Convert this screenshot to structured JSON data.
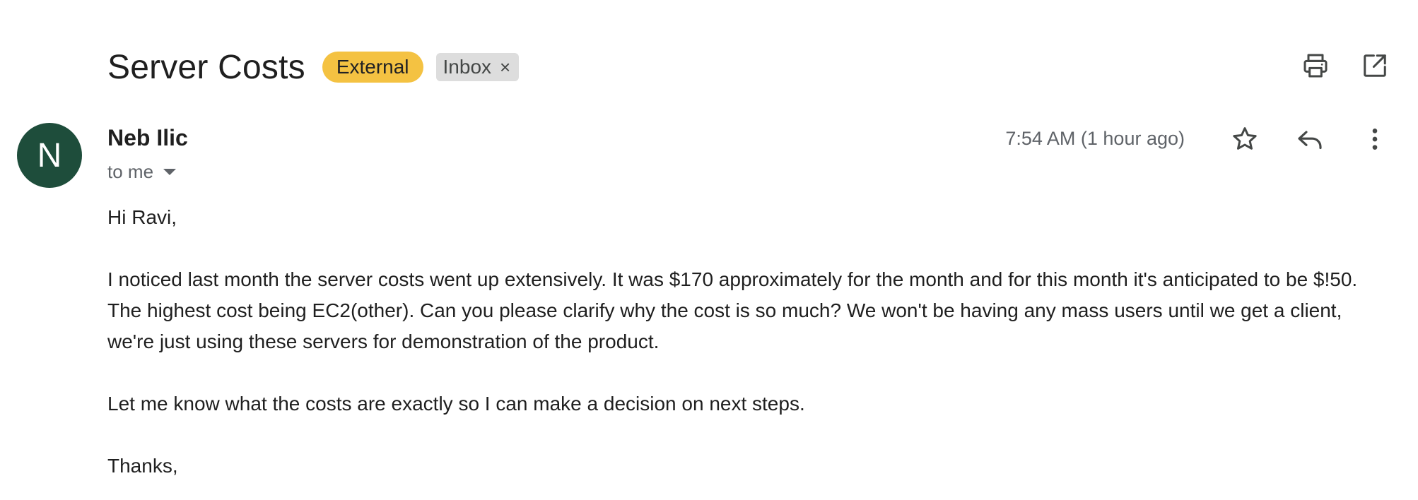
{
  "subject": "Server Costs",
  "labels": {
    "external": "External",
    "inbox": "Inbox",
    "inbox_remove": "×"
  },
  "toolbar": {
    "print_icon": "print-icon",
    "open_new_window_icon": "open-in-new-window-icon"
  },
  "message": {
    "avatar_initial": "N",
    "avatar_color": "#1e4d3b",
    "sender_name": "Neb Ilic",
    "recipient": "to me",
    "time": "7:54 AM (1 hour ago)",
    "actions": [
      "star-icon",
      "reply-icon",
      "more-vert-icon"
    ],
    "body": [
      "Hi Ravi,",
      "I noticed last month the server costs went up extensively. It was $170 approximately for the month and for this month it's anticipated to be $!50. The highest cost being EC2(other). Can you please clarify why the cost is so much? We won't be having any mass users until we get a client, we're just using these servers for demonstration of the product.",
      "Let me know what the costs are exactly so I can make a decision on next steps.",
      "Thanks,"
    ]
  },
  "colors": {
    "external_label": "#f4c242",
    "inbox_label": "#dddddd",
    "secondary_text": "#5f6368"
  }
}
